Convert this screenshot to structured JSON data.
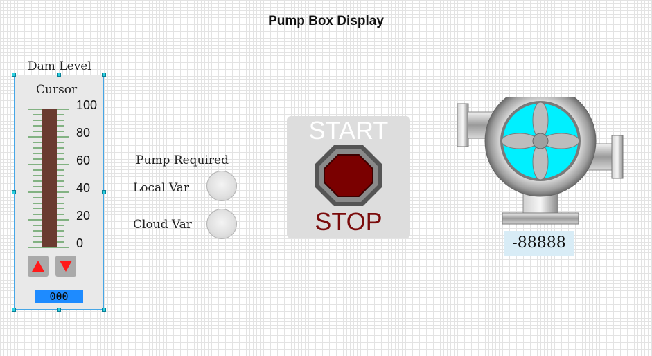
{
  "page": {
    "title": "Pump Box Display"
  },
  "dam_level": {
    "label": "Dam Level",
    "cursor_label": "Cursor",
    "scale_labels": [
      "100",
      "80",
      "60",
      "40",
      "20",
      "0"
    ],
    "level_percent": 100,
    "value_display": "000",
    "colors": {
      "bar": "#6a3b30",
      "ticks": "#1a7a1a",
      "arrows": "#ff1a1a",
      "value_box": "#1e8bff"
    },
    "icons": {
      "up": "up-arrow-icon",
      "down": "down-arrow-icon"
    }
  },
  "pump_required": {
    "label": "Pump Required",
    "local_var_label": "Local Var",
    "cloud_var_label": "Cloud Var",
    "local_state": "off",
    "cloud_state": "off"
  },
  "start_stop": {
    "start_label": "START",
    "stop_label": "STOP",
    "colors": {
      "button": "#7a0000",
      "stop_text": "#7a0b0b"
    },
    "icon": "octagon-stop-icon"
  },
  "pump": {
    "readout": "-88888",
    "colors": {
      "impeller_housing": "#00f0ff",
      "readout_bg": "#d8ecf6"
    },
    "icon": "centrifugal-pump-icon"
  }
}
